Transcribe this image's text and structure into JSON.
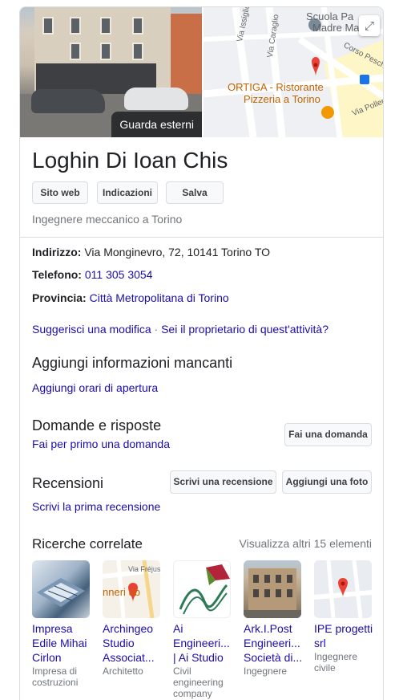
{
  "header_images": {
    "photo_button": "Guarda esterni",
    "map": {
      "labels": [
        "Via Issiglio",
        "Via Caraglio",
        "Corso Peschie",
        "Via Pollenzo",
        "Scuola Pa",
        "Madre Ma"
      ],
      "poi_line1": "ORTIGA - Ristorante",
      "poi_line2": "Pizzeria a Torino"
    }
  },
  "business": {
    "name": "Loghin Di Ioan Chis",
    "category": "Ingegnere meccanico a Torino",
    "actions": [
      "Sito web",
      "Indicazioni",
      "Salva"
    ]
  },
  "details": {
    "address_label": "Indirizzo:",
    "address": "Via Monginevro, 72, 10141 Torino TO",
    "phone_label": "Telefono:",
    "phone": "011 305 3054",
    "province_label": "Provincia:",
    "province": "Città Metropolitana di Torino"
  },
  "suggest": {
    "edit": "Suggerisci una modifica",
    "separator": "·",
    "owner": "Sei il proprietario di quest'attività?"
  },
  "missing_info": {
    "title": "Aggiungi informazioni mancanti",
    "link": "Aggiungi orari di apertura"
  },
  "qa": {
    "title": "Domande e risposte",
    "link": "Fai per primo una domanda",
    "button": "Fai una domanda"
  },
  "reviews": {
    "title": "Recensioni",
    "link": "Scrivi la prima recensione",
    "write_button": "Scrivi una recensione",
    "photo_button": "Aggiungi una foto"
  },
  "related": {
    "title": "Ricerche correlate",
    "more": "Visualizza altri 15 elementi",
    "items": [
      {
        "name": "Impresa Edile Mihai Cirlon",
        "category": "Impresa di costruzioni"
      },
      {
        "name": "Archingeo Studio Associat...",
        "category": "Architetto",
        "thumb_text": "nneri ub",
        "thumb_text2": "Via Fréjus"
      },
      {
        "name": "Ai Engineeri... | Ai Studio",
        "category": "Civil engineering company"
      },
      {
        "name": "Ark.I.Post Engineeri... Società di...",
        "category": "Ingegnere"
      },
      {
        "name": "IPE progetti srl",
        "category": "Ingegnere civile"
      }
    ]
  },
  "colors": {
    "link": "#1a0dab",
    "text": "#202124",
    "muted": "#70757a",
    "map_pin": "#ea4335",
    "poi": "#c26401"
  }
}
